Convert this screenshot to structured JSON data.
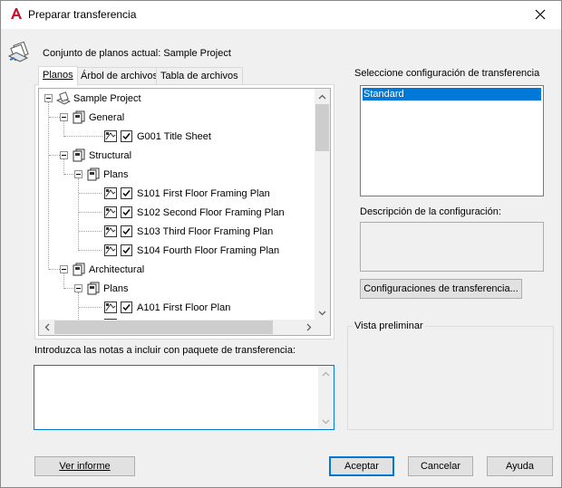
{
  "window": {
    "title": "Preparar transferencia",
    "app_icon": "autocad-a-icon",
    "close_icon": "close-icon"
  },
  "current_set": {
    "text": "Conjunto de planos actual: Sample Project",
    "icon": "sheet-set-icon"
  },
  "tabs": [
    {
      "label": "Planos",
      "active": true
    },
    {
      "label": "Árbol de archivos",
      "active": false
    },
    {
      "label": "Tabla de archivos",
      "active": false
    }
  ],
  "tree": {
    "root": "Sample Project",
    "general": "General",
    "g001": "G001 Title Sheet",
    "structural": "Structural",
    "plans": "Plans",
    "s101": "S101 First Floor Framing Plan",
    "s102": "S102 Second Floor Framing Plan",
    "s103": "S103 Third Floor Framing Plan",
    "s104": "S104 Fourth Floor Framing Plan",
    "architectural": "Architectural",
    "plans2": "Plans",
    "a101": "A101 First Floor Plan"
  },
  "notes": {
    "label": "Introduzca las notas a incluir con paquete de transferencia:",
    "value": ""
  },
  "config": {
    "label": "Seleccione configuración de transferencia",
    "items": [
      "Standard"
    ],
    "selected": "Standard",
    "description_label": "Descripción de la configuración:",
    "button": "Configuraciones de transferencia..."
  },
  "preview": {
    "label": "Vista preliminar"
  },
  "buttons": {
    "report": "Ver informe",
    "accept": "Aceptar",
    "cancel": "Cancelar",
    "help": "Ayuda"
  },
  "colors": {
    "selection": "#0078d7",
    "autocad_red": "#c8102e"
  }
}
